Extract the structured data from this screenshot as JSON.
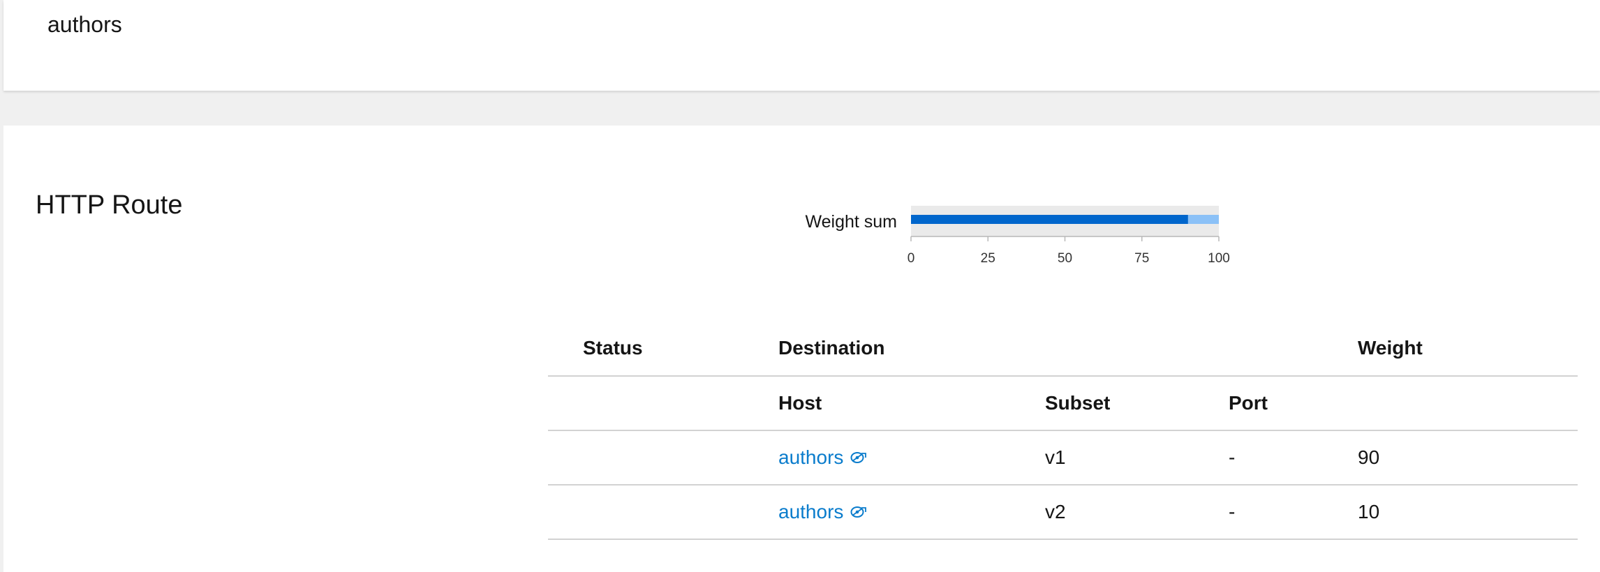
{
  "header": {
    "title": "authors"
  },
  "section": {
    "title": "HTTP Route"
  },
  "chart_data": {
    "type": "bar",
    "orientation": "horizontal",
    "categories": [
      "Weight sum"
    ],
    "series": [
      {
        "name": "v1",
        "values": [
          90
        ],
        "color": "#0066cc"
      },
      {
        "name": "v2",
        "values": [
          10
        ],
        "color": "#8bc1f7"
      }
    ],
    "xlim": [
      0,
      100
    ],
    "ticks": [
      "0",
      "25",
      "50",
      "75",
      "100"
    ],
    "background_color": "#eaeaea"
  },
  "table": {
    "headers": {
      "status": "Status",
      "destination": "Destination",
      "weight": "Weight"
    },
    "subheaders": {
      "host": "Host",
      "subset": "Subset",
      "port": "Port"
    },
    "rows": [
      {
        "status": "",
        "host": "authors",
        "host_icon": "service-link-icon",
        "subset": "v1",
        "port": "-",
        "weight": "90"
      },
      {
        "status": "",
        "host": "authors",
        "host_icon": "service-link-icon",
        "subset": "v2",
        "port": "-",
        "weight": "10"
      }
    ],
    "link_color": "#0a7ccc"
  }
}
